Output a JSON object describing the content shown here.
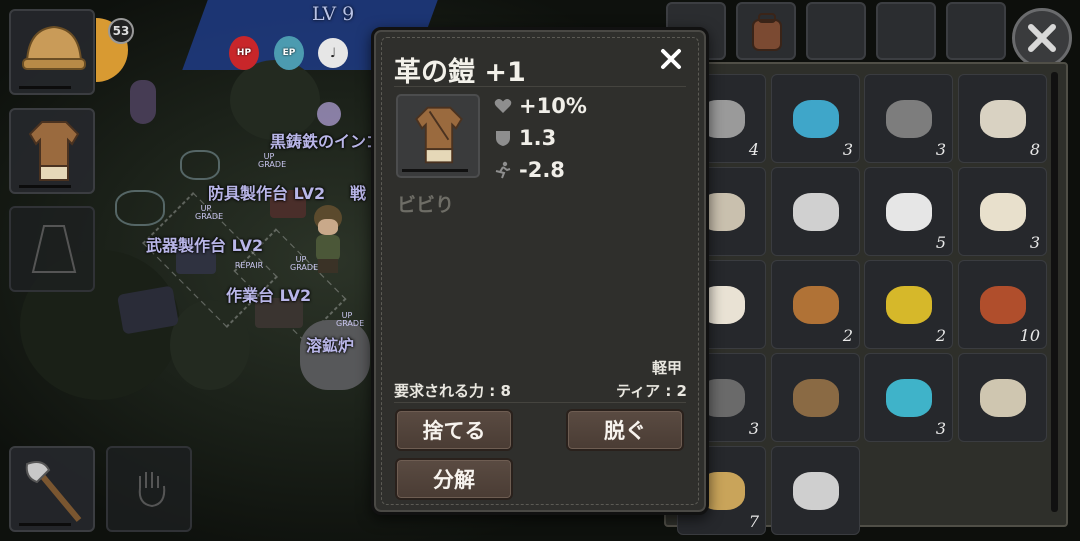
{
  "hud": {
    "level_text": "LV 9",
    "player_level_badge": "53",
    "stats": [
      {
        "label": "HP",
        "color": "#c8262a"
      },
      {
        "label": "EP",
        "color": "#4c9bb0"
      }
    ]
  },
  "map_labels": {
    "station_1": "黒鋳鉄のインゴット",
    "station_2": "防具製作台 LV2",
    "station_2_suffix": "戦",
    "station_3": "武器製作台 LV2",
    "station_4": "作業台 LV2",
    "station_5": "溶鉱炉",
    "upgrade_top": "UP",
    "upgrade_bottom": "GRADE",
    "repair": "REPAIR"
  },
  "item_detail": {
    "title": "革の鎧 +1",
    "stats": [
      {
        "icon": "heart-icon",
        "value": "+10%"
      },
      {
        "icon": "shield-icon",
        "value": "1.3"
      },
      {
        "icon": "running-icon",
        "value": "-2.8"
      }
    ],
    "description": "ビビり",
    "armor_type": "軽甲",
    "required_strength": "要求される力 : 8",
    "tier": "ティア : 2",
    "buttons": {
      "discard": "捨てる",
      "unequip": "脱ぐ",
      "disassemble": "分解"
    }
  },
  "inventory": {
    "cells": [
      {
        "name": "stone",
        "count": "4"
      },
      {
        "name": "blue-crystal",
        "count": "3"
      },
      {
        "name": "gear",
        "count": "3"
      },
      {
        "name": "bandage",
        "count": "8"
      },
      {
        "name": "bone-armor",
        "count": ""
      },
      {
        "name": "fish-skeleton",
        "count": ""
      },
      {
        "name": "white-ore",
        "count": "5"
      },
      {
        "name": "seeds",
        "count": "3"
      },
      {
        "name": "flint",
        "count": ""
      },
      {
        "name": "leather",
        "count": "2"
      },
      {
        "name": "sulfur",
        "count": "2"
      },
      {
        "name": "copper-ore",
        "count": "10"
      },
      {
        "name": "iron-ingot",
        "count": "3"
      },
      {
        "name": "pickaxe",
        "count": ""
      },
      {
        "name": "crystal-shards",
        "count": "3"
      },
      {
        "name": "map",
        "count": ""
      },
      {
        "name": "straw-bundle",
        "count": "7"
      },
      {
        "name": "silver-ore",
        "count": ""
      }
    ]
  }
}
